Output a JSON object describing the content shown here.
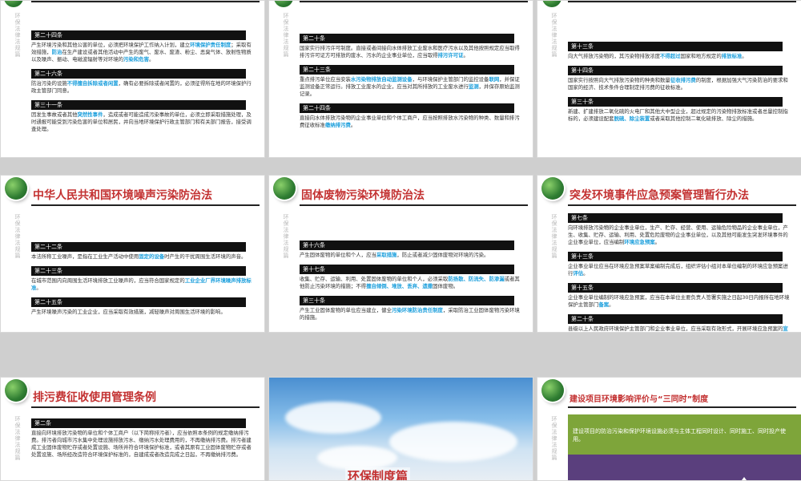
{
  "sidebar_label": "环保法律法规篇",
  "slides": [
    {
      "title": "",
      "articles": [
        {
          "head": "第二十四条",
          "parts": [
            [
              "产生环境污染和其他公害的单位，必须把环境保护工作纳入计划，建立",
              ""
            ],
            [
              "环境保护责任制度",
              "hl"
            ],
            [
              "；采取有效措施，",
              ""
            ],
            [
              "防治",
              "hl"
            ],
            [
              "在生产建设或者其他活动中产生的废气、废水、废渣、粉尘、恶臭气体、放射性物质以及噪声、振动、电磁波辐射等对环境的",
              ""
            ],
            [
              "污染和危害",
              "hl"
            ],
            [
              "。",
              ""
            ]
          ]
        },
        {
          "head": "第二十六条",
          "parts": [
            [
              "防治污染的设施",
              ""
            ],
            [
              "不得擅自拆除或者闲置",
              "hl"
            ],
            [
              "，确有必要拆除或者闲置的，必须征得所在地的环境保护行政主管部门同意。",
              ""
            ]
          ]
        },
        {
          "head": "第三十一条",
          "parts": [
            [
              "因发生事故或者其他",
              ""
            ],
            [
              "突然性事件",
              "hl"
            ],
            [
              "，造成或者可能造成污染事故的单位，必须立即采取措施处理，及时通报可能受到污染危害的单位和居民，并向当地环境保护行政主管部门和有关部门报告，接受调查处理。",
              ""
            ]
          ]
        }
      ]
    },
    {
      "title": "",
      "articles": [
        {
          "head": "第二十条",
          "parts": [
            [
              "国家实行排污许可制度。直接或者间接向水体排放工业废水和医疗污水以及其他按照规定应当取得排污许可证方可排放的废水、污水的企业事业单位，应当取得",
              ""
            ],
            [
              "排污许可证",
              "hl"
            ],
            [
              "。",
              ""
            ]
          ]
        },
        {
          "head": "第二十三条",
          "parts": [
            [
              "重点排污单位应当安装",
              ""
            ],
            [
              "水污染物排放自动监测设备",
              "hl"
            ],
            [
              "，与环境保护主管部门的监控设备",
              ""
            ],
            [
              "联网",
              "hl"
            ],
            [
              "，并保证监测设备正常运行。排放工业废水的企业，应当对其所排放的工业废水进行",
              ""
            ],
            [
              "监测",
              "hl"
            ],
            [
              "，并保存原始监测记录。",
              ""
            ]
          ]
        },
        {
          "head": "第二十四条",
          "parts": [
            [
              "直接向水体排放污染物的企业事业单位和个体工商户，应当按照排放水污染物的种类、数量和排污费征收标准",
              ""
            ],
            [
              "缴纳排污费",
              "hl"
            ],
            [
              "。",
              ""
            ]
          ]
        }
      ]
    },
    {
      "title": "",
      "articles": [
        {
          "head": "第十三条",
          "parts": [
            [
              "向大气排放污染物的，其污染物排放浓度",
              ""
            ],
            [
              "不得超过",
              "hl"
            ],
            [
              "国家和地方规定的",
              ""
            ],
            [
              "排放标准",
              "hl"
            ],
            [
              "。",
              ""
            ]
          ]
        },
        {
          "head": "第十四条",
          "parts": [
            [
              "国家实行按照向大气排放污染物的种类和数量",
              ""
            ],
            [
              "征收排污费",
              "hl"
            ],
            [
              "的制度，根据加强大气污染防治的要求和国家的经济、技术条件合理制定排污费的征收标准。",
              ""
            ]
          ]
        },
        {
          "head": "第三十条",
          "parts": [
            [
              "新建、扩建排放二氧化硫的火电厂和其他大中型企业，超过规定的污染物排放标准或者总量控制指标的，必须建设配套",
              ""
            ],
            [
              "脱硫、除尘装置",
              "hl"
            ],
            [
              "或者采取其他控制二氧化硫排放、除尘的措施。",
              ""
            ]
          ]
        }
      ]
    },
    {
      "title": "中华人民共和国环境噪声污染防治法",
      "articles": [
        {
          "head": "第二十二条",
          "parts": [
            [
              "本法所称工业噪声，是指在工业生产活动中使用",
              ""
            ],
            [
              "固定的设备",
              "hl"
            ],
            [
              "时产生的干扰周围生活环境的声音。",
              ""
            ]
          ]
        },
        {
          "head": "第二十三条",
          "parts": [
            [
              "在城市范围内向周围生活环境排放工业噪声的，应当符合国家规定的",
              ""
            ],
            [
              "工业企业厂界环境噪声排放标准",
              "hl"
            ],
            [
              "。",
              ""
            ]
          ]
        },
        {
          "head": "第二十五条",
          "parts": [
            [
              "产生环境噪声污染的工业企业，应当采取有效措施，减轻噪声对周围生活环境的影响。",
              ""
            ]
          ]
        }
      ]
    },
    {
      "title": "固体废物污染环境防治法",
      "articles": [
        {
          "head": "第十六条",
          "parts": [
            [
              "产生固体废物的单位和个人，应当",
              ""
            ],
            [
              "采取措施",
              "hl"
            ],
            [
              "，防止或者减少固体废物对环境的污染。",
              ""
            ]
          ]
        },
        {
          "head": "第十七条",
          "parts": [
            [
              "收集、贮存、运输、利用、处置固体废物的单位和个人，必须采取",
              ""
            ],
            [
              "防扬散、防流失、防渗漏",
              "hl"
            ],
            [
              "或者其他防止污染环境的措施；不得",
              ""
            ],
            [
              "擅自倾倒、堆放、丢弃、遗撒",
              "hl"
            ],
            [
              "固体废物。",
              ""
            ]
          ]
        },
        {
          "head": "第三十条",
          "parts": [
            [
              "产生工业固体废物的单位应当建立，健全",
              ""
            ],
            [
              "污染环境防治责任制度",
              "hl"
            ],
            [
              "，采取防治工业固体废物污染环境的措施。",
              ""
            ]
          ]
        }
      ]
    },
    {
      "title": "突发环境事件应急预案管理暂行办法",
      "articles": [
        {
          "head": "第七条",
          "parts": [
            [
              "向环境排放污染物的企业事业单位，生产、贮存、经营、使用、运输危险物品的企业事业单位，产生、收集、贮存、运输、利用、处置危险废物的企业事业单位，以及其他可能发生突发环境事件的企业事业单位，应当编制",
              ""
            ],
            [
              "环境应急预案",
              "hl"
            ],
            [
              "。",
              ""
            ]
          ]
        },
        {
          "head": "第十三条",
          "parts": [
            [
              "企业事业单位应当在环境应急预案草案编制完成后，组织评估小组对本单位编制的环境应急预案进行",
              ""
            ],
            [
              "评估",
              "hl"
            ],
            [
              "。",
              ""
            ]
          ]
        },
        {
          "head": "第十五条",
          "parts": [
            [
              "企业事业单位编制的环境应急预案，应当在本单位主要负责人签署实施之日起30日内报所在地环境保护主管部门",
              ""
            ],
            [
              "备案",
              "hl"
            ],
            [
              "。",
              ""
            ]
          ]
        },
        {
          "head": "第二十条",
          "parts": [
            [
              "县级以上人民政府环境保护主管部门和企业事业单位，应当采取有效形式，开展环境应急预案的",
              ""
            ],
            [
              "宣传教育",
              "hl"
            ],
            [
              "，普及突发环境事件预防、避险、自救、互救和应急处置知识，提高从业人员环境安全意识和应急处置技能。",
              ""
            ]
          ]
        }
      ]
    },
    {
      "title": "排污费征收使用管理条例",
      "articles": [
        {
          "head": "第二条",
          "parts": [
            [
              "直接向环境排放污染物的单位和个体工商户（以下简称排污者），应当依照本条例的规定缴纳排污费。排污者向城市污水集中处理设施排放污水、缴纳污水处理费用的，不再缴纳排污费。排污者建成工业固体废物贮存或者处置设施、场所并符合环境保护标准，或者其原有工业固体废物贮存或者处置设施、场所经改造符合环境保护标准的，自建成或者改造完成之日起，不再缴纳排污费。",
              ""
            ]
          ]
        }
      ]
    },
    {
      "title": "环保制度篇",
      "articles": []
    },
    {
      "title": "建设项目环境影响评价与“三同时”制度",
      "band_text": "建设项目的防治污染和保护环境设施必须与主体工程同时设计、同时施工、同时投产使用。",
      "articles": []
    }
  ]
}
